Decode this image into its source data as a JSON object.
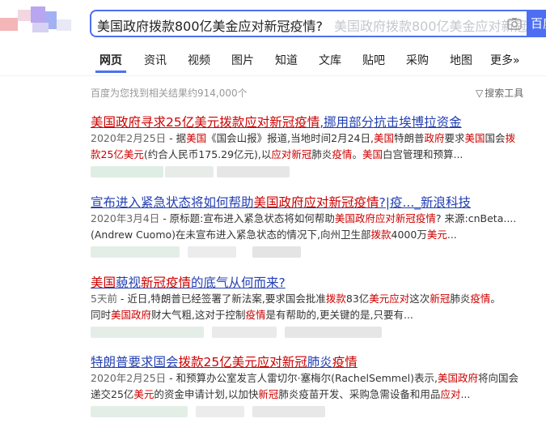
{
  "search": {
    "query": "美国政府拨款800亿美金应对新冠疫情?",
    "suggestion": "美国政府拨款800亿美金应对新冠疫情",
    "button_label": "百度一下"
  },
  "tabs": [
    {
      "label": "网页",
      "active": true
    },
    {
      "label": "资讯"
    },
    {
      "label": "视频"
    },
    {
      "label": "图片"
    },
    {
      "label": "知道"
    },
    {
      "label": "文库"
    },
    {
      "label": "贴吧"
    },
    {
      "label": "采购"
    },
    {
      "label": "地图"
    },
    {
      "label": "更多»"
    }
  ],
  "result_count": "百度为您找到相关结果约914,000个",
  "tools_label": "搜索工具",
  "results": [
    {
      "title": [
        {
          "t": "美国政府寻求25亿美元拨款应对新冠疫情",
          "hl": true
        },
        {
          "t": ",挪用部分抗击埃博拉资金",
          "hl": false
        }
      ],
      "lines": [
        [
          {
            "t": "2020年2月25日",
            "c": "date"
          },
          {
            "t": " - 据"
          },
          {
            "t": "美国",
            "hl": true
          },
          {
            "t": "《国会山报》报道,当地时间2月24日,"
          },
          {
            "t": "美国",
            "hl": true
          },
          {
            "t": "特朗普"
          },
          {
            "t": "政府",
            "hl": true
          },
          {
            "t": "要求"
          },
          {
            "t": "美国",
            "hl": true
          },
          {
            "t": "国会"
          },
          {
            "t": "拨",
            "hl": true
          }
        ],
        [
          {
            "t": "款",
            "hl": true
          },
          {
            "t": "25亿美元",
            "hl": true
          },
          {
            "t": "(约合人民币175.29亿元),以"
          },
          {
            "t": "应对新冠",
            "hl": true
          },
          {
            "t": "肺炎"
          },
          {
            "t": "疫情",
            "hl": true
          },
          {
            "t": "。"
          },
          {
            "t": "美国",
            "hl": true
          },
          {
            "t": "白宫管理和预算..."
          }
        ]
      ]
    },
    {
      "title": [
        {
          "t": "宣布进入紧急状态将如何帮助",
          "hl": false
        },
        {
          "t": "美国政府应对新冠疫情",
          "hl": true
        },
        {
          "t": "?|疫..._新浪科技",
          "hl": false
        }
      ],
      "lines": [
        [
          {
            "t": "2020年3月4日",
            "c": "date"
          },
          {
            "t": " - 原标题:宣布进入紧急状态将如何帮助"
          },
          {
            "t": "美国政府应对新冠疫情",
            "hl": true
          },
          {
            "t": "? 来源:cnBeta...."
          }
        ],
        [
          {
            "t": "(Andrew Cuomo)在未宣布进入紧急状态的情况下,向州卫生部"
          },
          {
            "t": "拨款",
            "hl": true
          },
          {
            "t": "4000万"
          },
          {
            "t": "美元",
            "hl": true
          },
          {
            "t": "..."
          }
        ]
      ]
    },
    {
      "title": [
        {
          "t": "美国",
          "hl": true
        },
        {
          "t": "藐视",
          "hl": false
        },
        {
          "t": "新冠疫情",
          "hl": true
        },
        {
          "t": "的底气从何而来?",
          "hl": false
        }
      ],
      "lines": [
        [
          {
            "t": "5天前",
            "c": "date"
          },
          {
            "t": " - 近日,特朗普已经签署了新法案,要求国会批准"
          },
          {
            "t": "拨款",
            "hl": true
          },
          {
            "t": "83亿"
          },
          {
            "t": "美元应对",
            "hl": true
          },
          {
            "t": "这次"
          },
          {
            "t": "新冠",
            "hl": true
          },
          {
            "t": "肺炎"
          },
          {
            "t": "疫情",
            "hl": true
          },
          {
            "t": "。"
          }
        ],
        [
          {
            "t": "同时"
          },
          {
            "t": "美国政府",
            "hl": true
          },
          {
            "t": "财大气粗,这对于控制"
          },
          {
            "t": "疫情",
            "hl": true
          },
          {
            "t": "是有帮助的,更关键的是,只要有..."
          }
        ]
      ]
    },
    {
      "title": [
        {
          "t": "特朗普要求国会",
          "hl": false
        },
        {
          "t": "拨款25亿美元应对新冠",
          "hl": true
        },
        {
          "t": "肺炎",
          "hl": false
        },
        {
          "t": "疫情",
          "hl": true
        }
      ],
      "lines": [
        [
          {
            "t": "2020年2月25日",
            "c": "date"
          },
          {
            "t": " - 和预算办公室发言人雷切尔·塞梅尔(RachelSemmel)表示,"
          },
          {
            "t": "美国政府",
            "hl": true
          },
          {
            "t": "将向国会"
          }
        ],
        [
          {
            "t": "递交25亿"
          },
          {
            "t": "美元",
            "hl": true
          },
          {
            "t": "的资金申请计划,以加快"
          },
          {
            "t": "新冠",
            "hl": true
          },
          {
            "t": "肺炎疫苗开发、采购急需设备和用品"
          },
          {
            "t": "应对",
            "hl": true
          },
          {
            "t": "..."
          }
        ]
      ]
    }
  ],
  "colors": {
    "accent": "#4e6ef2",
    "link": "#2440b3",
    "highlight": "#cc0000"
  }
}
